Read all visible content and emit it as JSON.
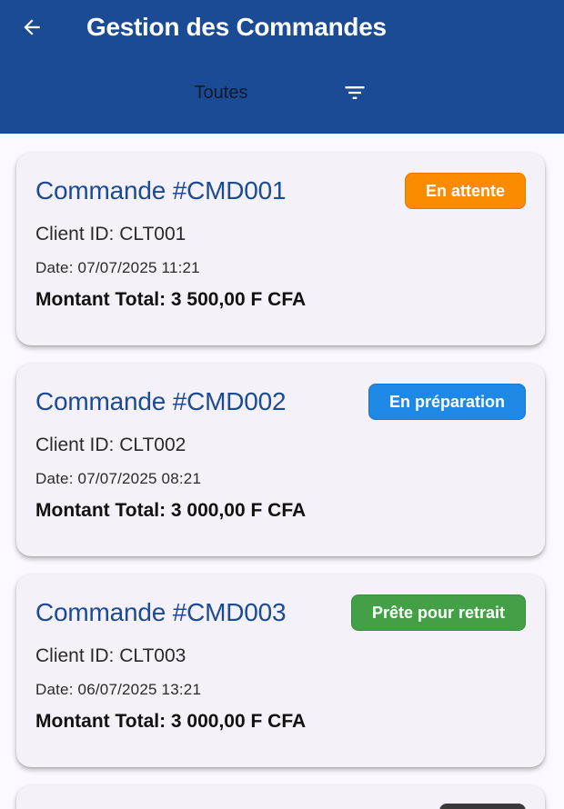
{
  "app_bar": {
    "title": "Gestion des Commandes",
    "back_icon": "arrow-left-icon",
    "background": "#1b4b94"
  },
  "filter": {
    "selected": "Toutes",
    "icon": "filter-list-icon"
  },
  "orders": [
    {
      "title": "Commande #CMD001",
      "client": "Client ID: CLT001",
      "date": "Date: 07/07/2025 11:21",
      "total": "Montant Total: 3 500,00 F CFA",
      "status": "En attente",
      "status_color": "#fb8c00"
    },
    {
      "title": "Commande #CMD002",
      "client": "Client ID: CLT002",
      "date": "Date: 07/07/2025 08:21",
      "total": "Montant Total: 3 000,00 F CFA",
      "status": "En préparation",
      "status_color": "#1e88e5"
    },
    {
      "title": "Commande #CMD003",
      "client": "Client ID: CLT003",
      "date": "Date: 06/07/2025 13:21",
      "total": "Montant Total: 3 000,00 F CFA",
      "status": "Prête pour retrait",
      "status_color": "#43a047"
    }
  ]
}
